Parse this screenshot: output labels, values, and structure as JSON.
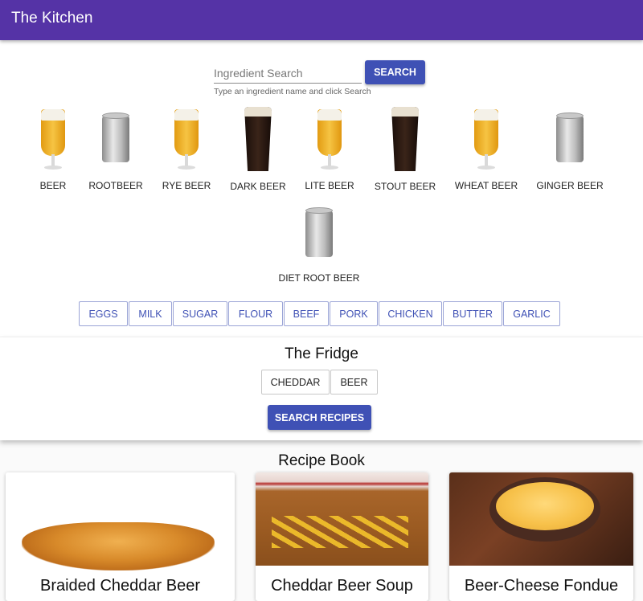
{
  "app": {
    "title": "The Kitchen"
  },
  "search": {
    "placeholder": "Ingredient Search",
    "helper": "Type an ingredient name and click Search",
    "button_label": "SEARCH"
  },
  "drinks": [
    {
      "label": "BEER",
      "image": "beer-glass-icon"
    },
    {
      "label": "ROOTBEER",
      "image": "can-icon"
    },
    {
      "label": "RYE BEER",
      "image": "beer-glass-icon"
    },
    {
      "label": "DARK BEER",
      "image": "dark-pint-icon"
    },
    {
      "label": "LITE BEER",
      "image": "beer-glass-icon"
    },
    {
      "label": "STOUT BEER",
      "image": "dark-pint-icon"
    },
    {
      "label": "WHEAT BEER",
      "image": "beer-glass-icon"
    },
    {
      "label": "GINGER BEER",
      "image": "can-icon"
    },
    {
      "label": "DIET ROOT BEER",
      "image": "can-icon"
    }
  ],
  "ingredients": [
    "EGGS",
    "MILK",
    "SUGAR",
    "FLOUR",
    "BEEF",
    "PORK",
    "CHICKEN",
    "BUTTER",
    "GARLIC"
  ],
  "fridge": {
    "title": "The Fridge",
    "items": [
      "CHEDDAR",
      "BEER"
    ],
    "search_button": "SEARCH RECIPES"
  },
  "recipe_book": {
    "title": "Recipe Book",
    "recipes": [
      {
        "name": "Braided Cheddar Beer"
      },
      {
        "name": "Cheddar Beer Soup"
      },
      {
        "name": "Beer-Cheese Fondue"
      }
    ]
  },
  "colors": {
    "appbar": "#5533a6",
    "primary": "#3f51b5"
  }
}
